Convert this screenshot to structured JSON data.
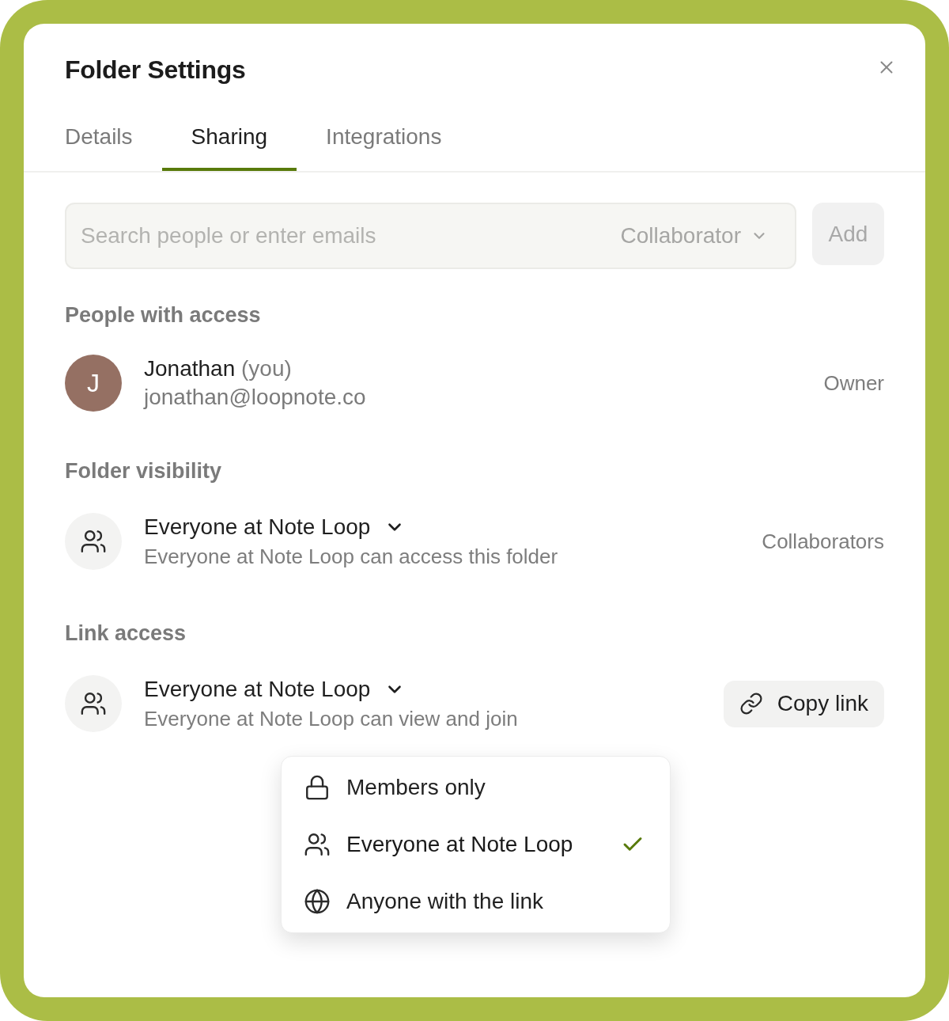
{
  "dialog": {
    "title": "Folder Settings"
  },
  "tabs": [
    {
      "label": "Details",
      "selected": false
    },
    {
      "label": "Sharing",
      "selected": true
    },
    {
      "label": "Integrations",
      "selected": false
    }
  ],
  "invite": {
    "placeholder": "Search people or enter emails",
    "role": "Collaborator",
    "add_button": {
      "label": "Add",
      "disabled": true
    }
  },
  "people": {
    "heading": "People with access",
    "members": [
      {
        "initial": "J",
        "name": "Jonathan",
        "note": "(you)",
        "email": "jonathan@loopnote.co",
        "role": "Owner",
        "color": "#957063"
      }
    ]
  },
  "visibility": {
    "heading": "Folder visibility",
    "kind": "people",
    "option": "Everyone at Note Loop",
    "description": "Everyone at Note Loop can access this folder",
    "role": "Collaborators"
  },
  "link_access": {
    "heading": "Link access",
    "kind": "people",
    "option": "Everyone at Note Loop",
    "description": "Everyone at Note Loop can view and join",
    "copy_button": "Copy link",
    "expanded": true,
    "menu": [
      {
        "kind": "lock",
        "label": "Members only",
        "selected": false
      },
      {
        "kind": "people",
        "label": "Everyone at Note Loop",
        "selected": true
      },
      {
        "kind": "globe",
        "label": "Anyone with the link",
        "selected": false
      }
    ]
  }
}
